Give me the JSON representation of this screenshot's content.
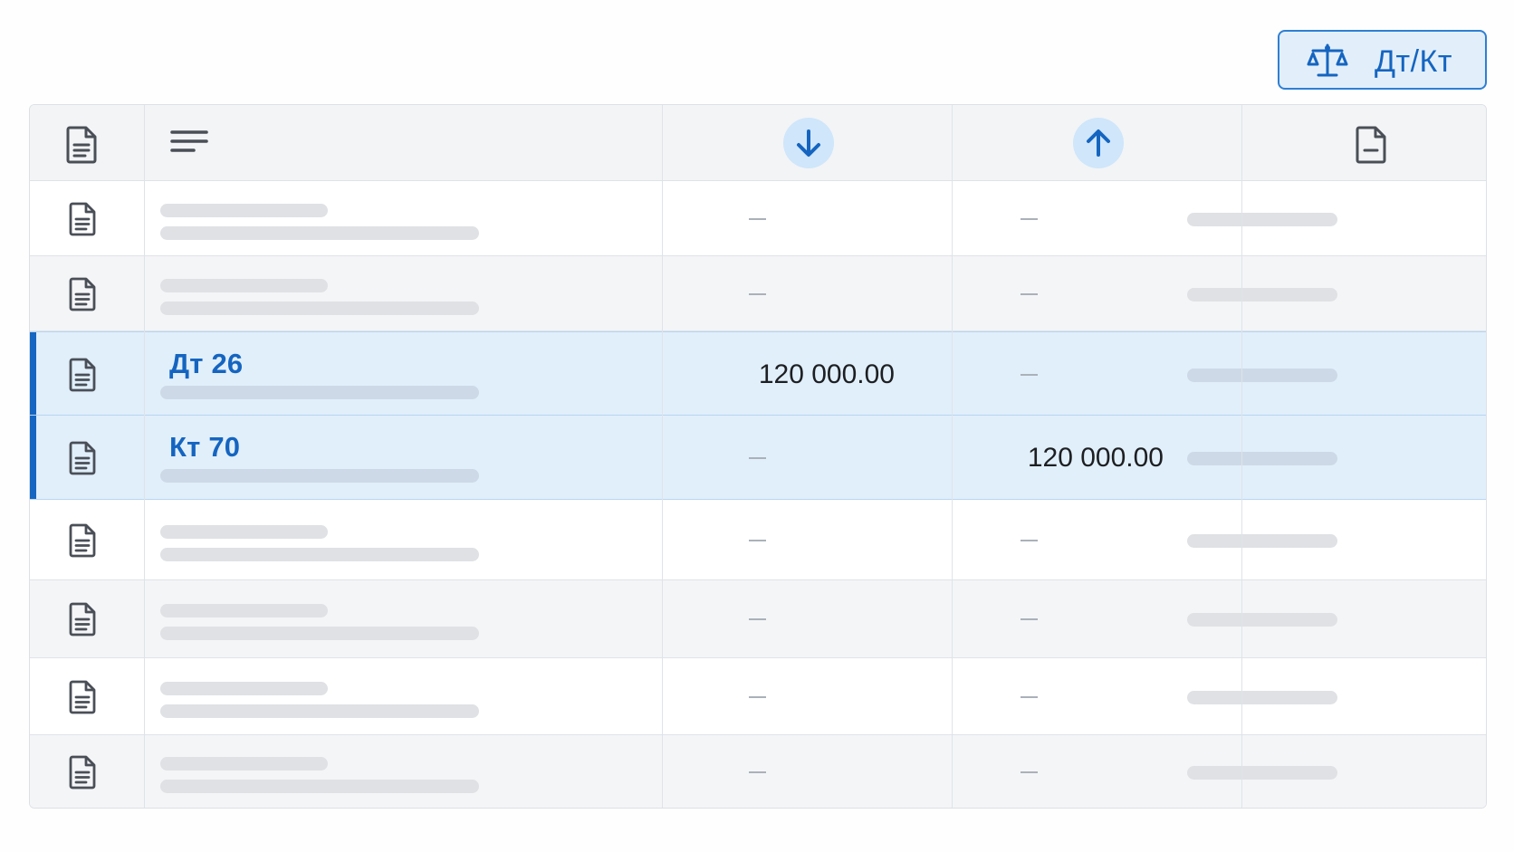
{
  "toolbar": {
    "toggle_label": "Дт/Кт",
    "toggle_icon": "scales-icon",
    "accent_color": "#1565c0"
  },
  "table": {
    "header_icons": [
      "document-icon",
      "lines-icon",
      "arrow-down-icon",
      "arrow-up-icon",
      "document-minus-icon"
    ],
    "rows": [
      {
        "placeholder": true,
        "debit": "",
        "credit": ""
      },
      {
        "placeholder": true,
        "debit": "",
        "credit": ""
      },
      {
        "account": "Дт 26",
        "debit": "120 000.00",
        "credit": "",
        "selected": true
      },
      {
        "account": "Кт 70",
        "debit": "",
        "credit": "120 000.00",
        "selected": true
      },
      {
        "placeholder": true,
        "debit": "",
        "credit": ""
      },
      {
        "placeholder": true,
        "debit": "",
        "credit": ""
      },
      {
        "placeholder": true,
        "debit": "",
        "credit": ""
      },
      {
        "placeholder": true,
        "debit": "",
        "credit": ""
      }
    ]
  }
}
